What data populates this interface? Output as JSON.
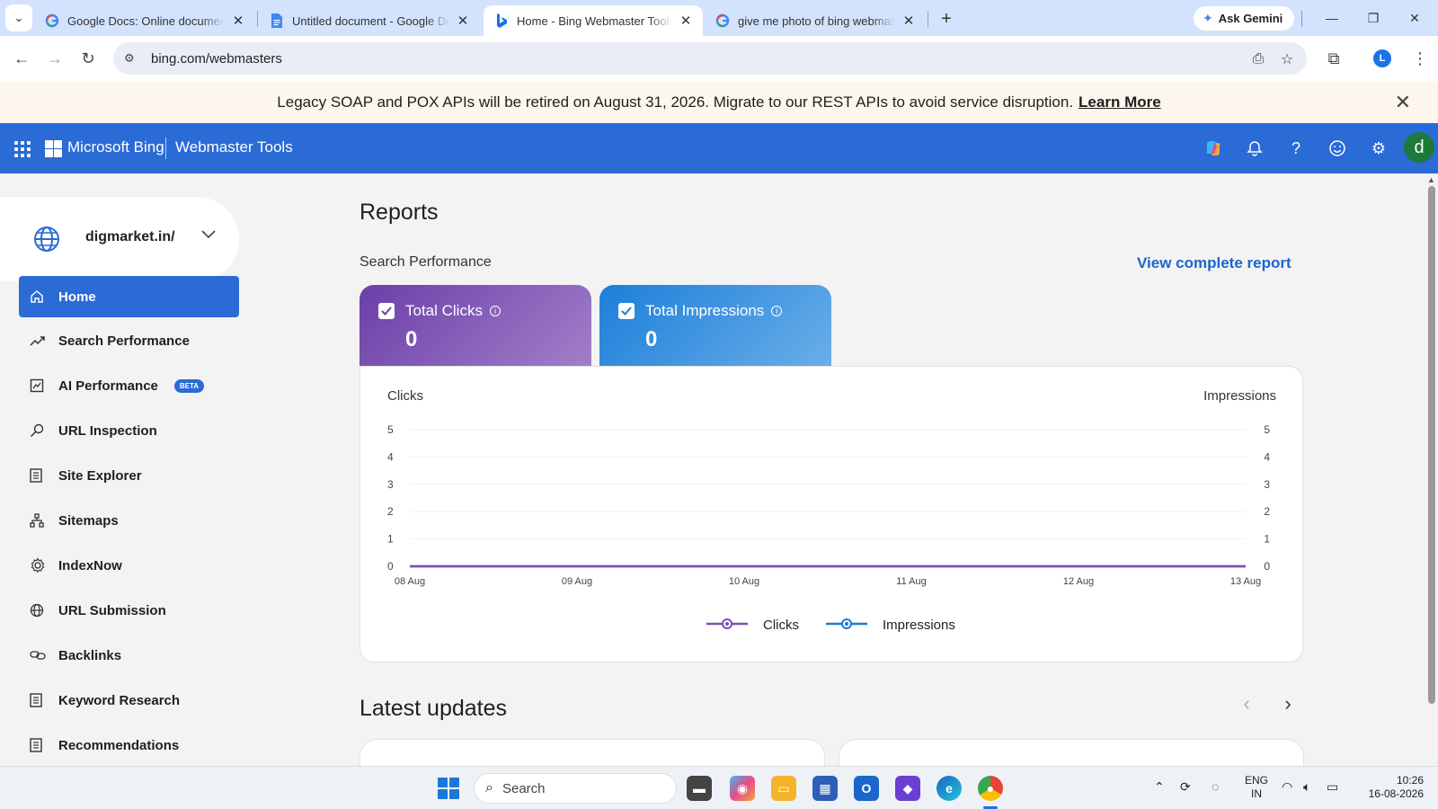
{
  "browser": {
    "tabs": [
      {
        "title": "Google Docs: Online document",
        "favicon": "google-icon"
      },
      {
        "title": "Untitled document - Google Docs",
        "favicon": "docs-icon"
      },
      {
        "title": "Home - Bing Webmaster Tools",
        "favicon": "bing-icon",
        "active": true
      },
      {
        "title": "give me photo of bing webmaster",
        "favicon": "google-icon"
      }
    ],
    "tab_close": "✕",
    "new_tab": "+",
    "ask_gemini": "Ask Gemini",
    "url": "bing.com/webmasters",
    "profile_initial": "L"
  },
  "banner": {
    "text": "Legacy SOAP and POX APIs will be retired on August 31, 2026. Migrate to our REST APIs to avoid service disruption.",
    "link": "Learn More"
  },
  "header": {
    "brand": "Microsoft Bing",
    "product": "Webmaster Tools",
    "avatar_initial": "d",
    "accent": "#2a6bd6"
  },
  "sidebar": {
    "site": "digmarket.in/",
    "items": [
      {
        "label": "Home",
        "icon": "home-icon",
        "active": true
      },
      {
        "label": "Search Performance",
        "icon": "trend-icon"
      },
      {
        "label": "AI Performance",
        "icon": "ai-icon",
        "badge": "BETA"
      },
      {
        "label": "URL Inspection",
        "icon": "search-icon"
      },
      {
        "label": "Site Explorer",
        "icon": "document-icon"
      },
      {
        "label": "Sitemaps",
        "icon": "sitemap-icon"
      },
      {
        "label": "IndexNow",
        "icon": "gear-icon"
      },
      {
        "label": "URL Submission",
        "icon": "globe-icon"
      },
      {
        "label": "Backlinks",
        "icon": "link-icon"
      },
      {
        "label": "Keyword Research",
        "icon": "document-icon"
      },
      {
        "label": "Recommendations",
        "icon": "document-icon"
      }
    ]
  },
  "main": {
    "title": "Reports",
    "section": "Search Performance",
    "view_report": "View complete report",
    "metrics": [
      {
        "label": "Total Clicks",
        "value": "0",
        "color": "#7e4fb6"
      },
      {
        "label": "Total Impressions",
        "value": "0",
        "color": "#2a8ae0"
      }
    ],
    "latest_updates": "Latest updates"
  },
  "chart_data": {
    "type": "line",
    "ylabel": "Clicks",
    "y2label": "Impressions",
    "ylim": [
      0,
      5
    ],
    "y2lim": [
      0,
      5
    ],
    "yticks": [
      "0",
      "1",
      "2",
      "3",
      "4",
      "5"
    ],
    "categories": [
      "08 Aug",
      "09 Aug",
      "10 Aug",
      "11 Aug",
      "12 Aug",
      "13 Aug"
    ],
    "series": [
      {
        "name": "Clicks",
        "values": [
          0,
          0,
          0,
          0,
          0,
          0
        ],
        "color": "#7e4fb6"
      },
      {
        "name": "Impressions",
        "values": [
          0,
          0,
          0,
          0,
          0,
          0
        ],
        "color": "#1f7ad6"
      }
    ],
    "legend": "bottom",
    "grid": true
  },
  "taskbar": {
    "search_placeholder": "Search",
    "lang_line1": "ENG",
    "lang_line2": "IN",
    "time": "10:26",
    "date": "16-08-2026"
  }
}
